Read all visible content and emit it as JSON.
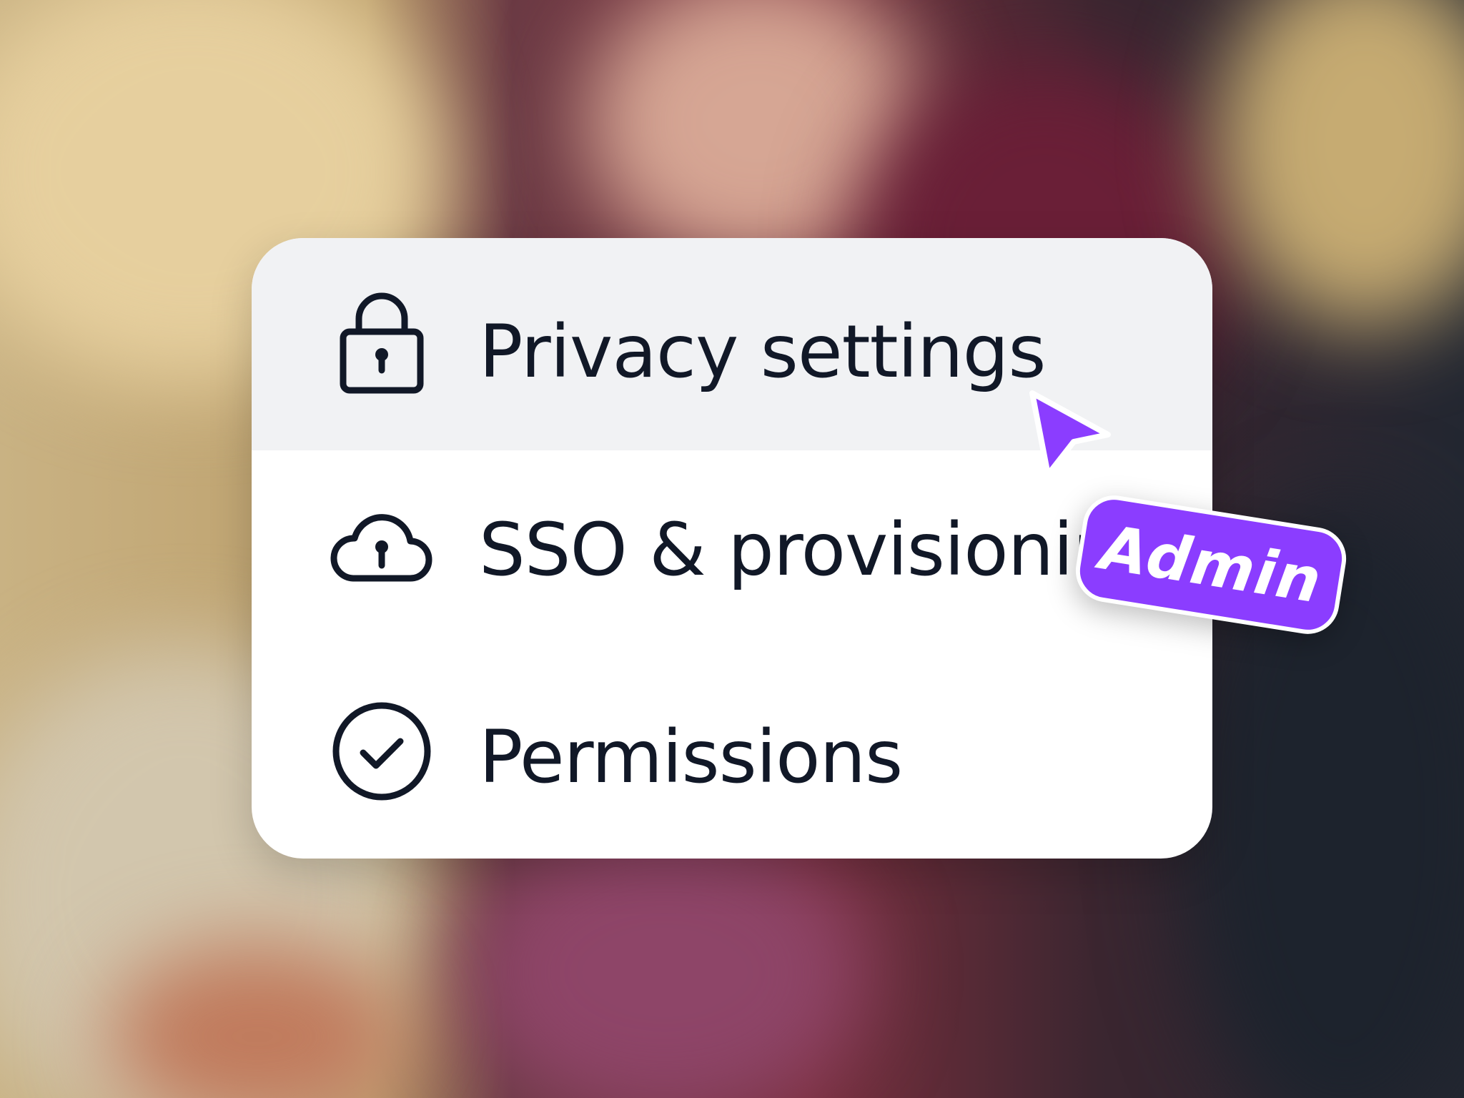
{
  "menu": {
    "items": [
      {
        "label": "Privacy settings",
        "icon": "lock-icon",
        "state": "hovered"
      },
      {
        "label": "SSO & provisioning",
        "icon": "cloud-lock-icon",
        "state": "default"
      },
      {
        "label": "Permissions",
        "icon": "check-circle-icon",
        "state": "default"
      }
    ]
  },
  "cursor": {
    "icon": "pointer-arrow-icon",
    "color": "#8b3dff"
  },
  "badge": {
    "label": "Admin",
    "color": "#8b3dff"
  },
  "colors": {
    "text": "#111827",
    "hover_background": "#f1f2f4",
    "card_background": "#ffffff",
    "accent": "#8b3dff"
  }
}
